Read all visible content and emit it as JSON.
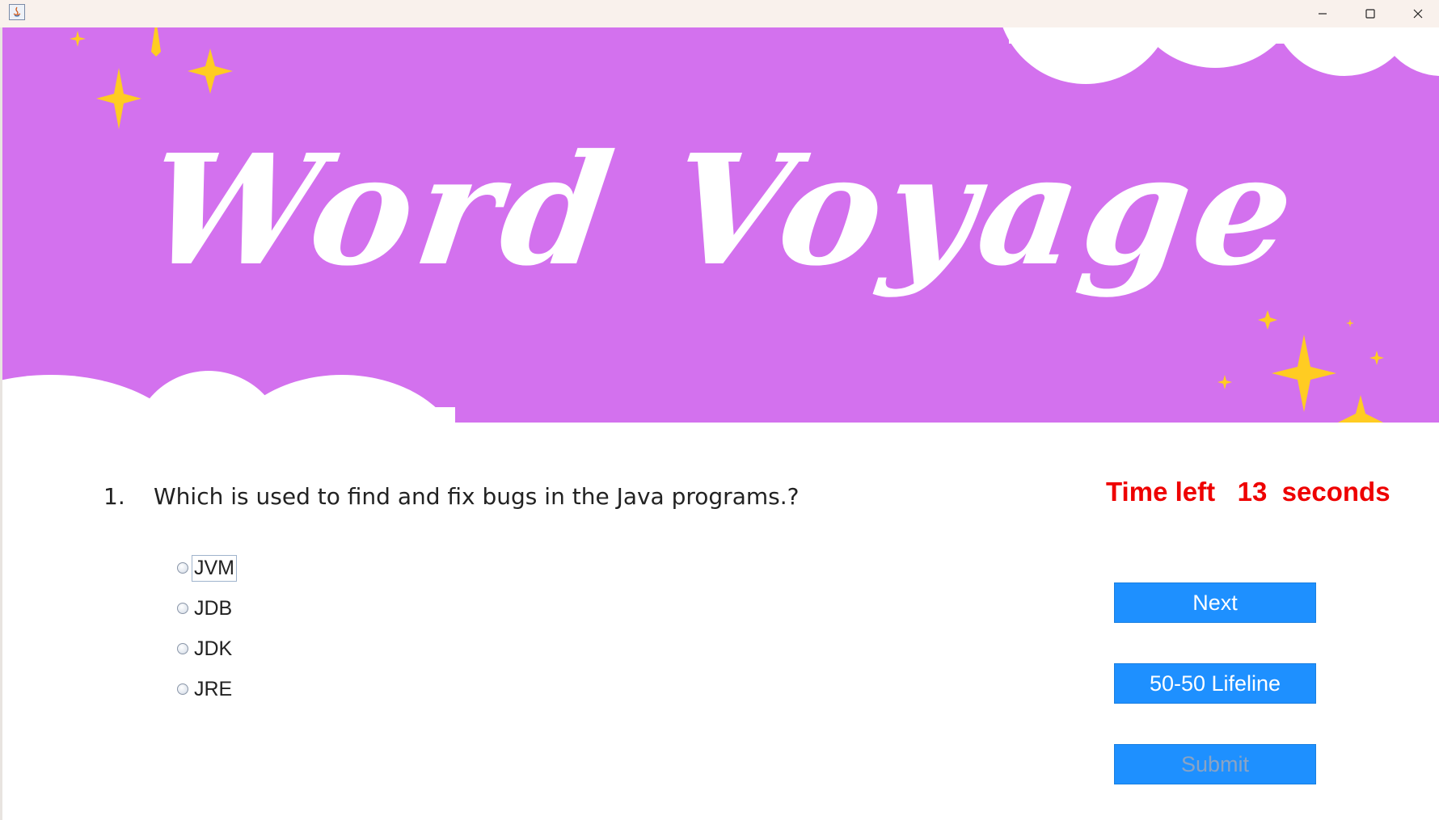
{
  "window": {
    "controls": {
      "minimize": "minimize-icon",
      "maximize": "maximize-icon",
      "close": "close-icon"
    }
  },
  "banner": {
    "title": "Word Voyage",
    "background_color": "#d371ee",
    "star_color": "#ffcc22"
  },
  "question": {
    "number": "1.",
    "text": "Which is used to find and fix bugs in the Java programs.?"
  },
  "timer": {
    "label": "Time left",
    "value": "13",
    "unit": "seconds",
    "color": "#ee0000"
  },
  "options": [
    {
      "label": "JVM",
      "selected": false,
      "focused": true
    },
    {
      "label": "JDB",
      "selected": false,
      "focused": false
    },
    {
      "label": "JDK",
      "selected": false,
      "focused": false
    },
    {
      "label": "JRE",
      "selected": false,
      "focused": false
    }
  ],
  "buttons": {
    "next": "Next",
    "lifeline": "50-50 Lifeline",
    "submit": "Submit",
    "color": "#1e90ff"
  }
}
